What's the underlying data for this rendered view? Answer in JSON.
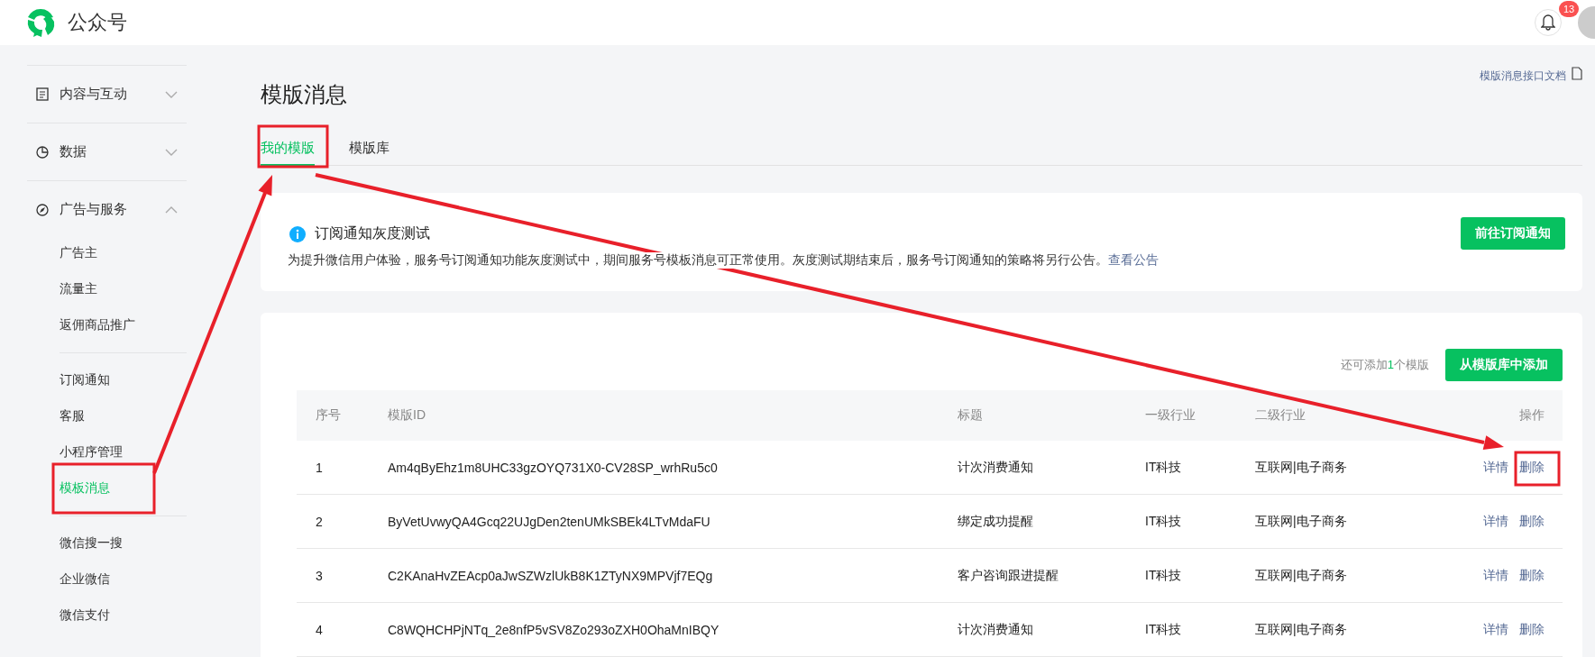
{
  "header": {
    "title": "公众号",
    "notification_count": "13"
  },
  "sidebar": [
    {
      "label": "内容与互动",
      "kind": "document",
      "expanded": false
    },
    {
      "label": "数据",
      "kind": "chart",
      "expanded": false
    },
    {
      "label": "广告与服务",
      "kind": "compass",
      "expanded": true,
      "groups": [
        [
          {
            "label": "广告主",
            "selected": false
          },
          {
            "label": "流量主",
            "selected": false
          },
          {
            "label": "返佣商品推广",
            "selected": false
          }
        ],
        [
          {
            "label": "订阅通知",
            "selected": false
          },
          {
            "label": "客服",
            "selected": false
          },
          {
            "label": "小程序管理",
            "selected": false
          },
          {
            "label": "模板消息",
            "selected": true
          }
        ],
        [
          {
            "label": "微信搜一搜",
            "selected": false
          },
          {
            "label": "企业微信",
            "selected": false
          },
          {
            "label": "微信支付",
            "selected": false
          }
        ]
      ]
    }
  ],
  "page": {
    "title": "模版消息",
    "doc_link": "模版消息接口文档"
  },
  "tabs": [
    {
      "label": "我的模版",
      "selected": true
    },
    {
      "label": "模版库",
      "selected": false
    }
  ],
  "notice": {
    "title": "订阅通知灰度测试",
    "text": "为提升微信用户体验，服务号订阅通知功能灰度测试中，期间服务号模板消息可正常使用。灰度测试期结束后，服务号订阅通知的策略将另行公告。",
    "link": "查看公告",
    "button": "前往订阅通知"
  },
  "table": {
    "quota": {
      "before": "还可添加",
      "count": "1",
      "after": "个模版"
    },
    "add_button": "从模版库中添加",
    "columns": [
      "序号",
      "模版ID",
      "标题",
      "一级行业",
      "二级行业",
      "操作"
    ],
    "rows": [
      {
        "cells": [
          "1",
          "Am4qByEhz1m8UHC33gzOYQ731X0-CV28SP_wrhRu5c0",
          "计次消费通知",
          "IT科技",
          "互联网|电子商务"
        ],
        "actions": [
          "详情",
          "删除"
        ]
      },
      {
        "cells": [
          "2",
          "ByVetUvwyQA4Gcq22UJgDen2tenUMkSBEk4LTvMdaFU",
          "绑定成功提醒",
          "IT科技",
          "互联网|电子商务"
        ],
        "actions": [
          "详情",
          "删除"
        ]
      },
      {
        "cells": [
          "3",
          "C2KAnaHvZEAcp0aJwSZWzlUkB8K1ZTyNX9MPVjf7EQg",
          "客户咨询跟进提醒",
          "IT科技",
          "互联网|电子商务"
        ],
        "actions": [
          "详情",
          "删除"
        ]
      },
      {
        "cells": [
          "4",
          "C8WQHCHPjNTq_2e8nfP5vSV8Zo293oZXH0OhaMnIBQY",
          "计次消费通知",
          "IT科技",
          "互联网|电子商务"
        ],
        "actions": [
          "详情",
          "删除"
        ]
      }
    ]
  }
}
